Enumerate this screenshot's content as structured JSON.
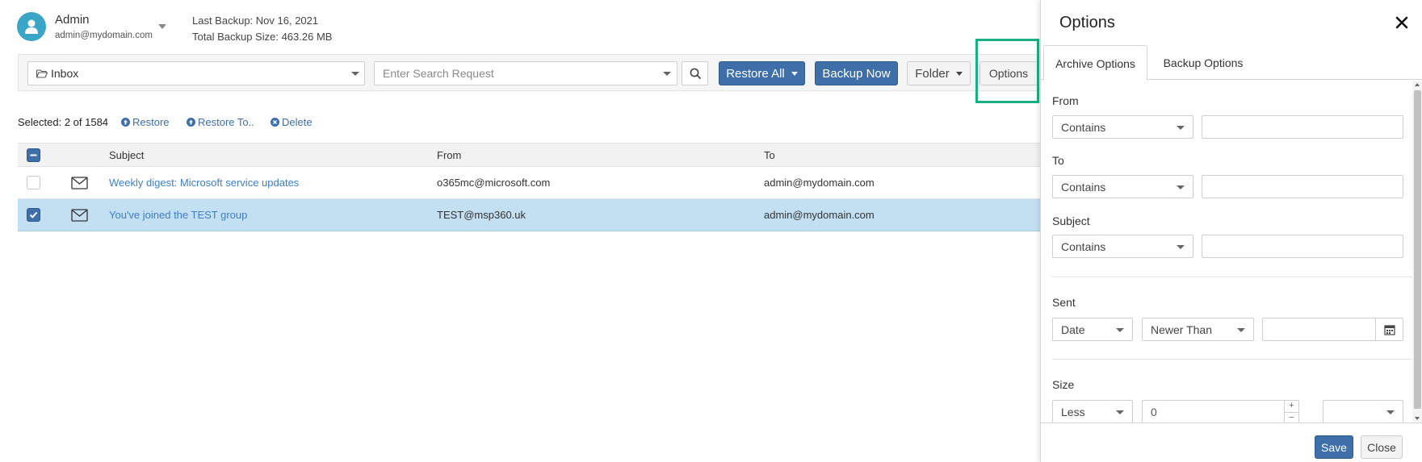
{
  "header": {
    "user_name": "Admin",
    "user_email": "admin@mydomain.com",
    "last_backup_label": "Last Backup:",
    "last_backup_value": "Nov 16, 2021",
    "total_size_label": "Total Backup Size:",
    "total_size_value": "463.26 MB"
  },
  "toolbar": {
    "folder": "Inbox",
    "search_placeholder": "Enter Search Request",
    "restore_all": "Restore All",
    "backup_now": "Backup Now",
    "folder_button": "Folder",
    "options_button": "Options"
  },
  "actions": {
    "selected": "Selected: 2 of 1584",
    "restore": "Restore",
    "restore_to": "Restore To..",
    "delete": "Delete"
  },
  "table": {
    "columns": [
      "Subject",
      "From",
      "To"
    ],
    "rows": [
      {
        "subject": "Weekly digest: Microsoft service updates",
        "from": "o365mc@microsoft.com",
        "to": "admin@mydomain.com",
        "checked": false
      },
      {
        "subject": "You've joined the TEST group",
        "from": "TEST@msp360.uk",
        "to": "admin@mydomain.com",
        "checked": true
      }
    ]
  },
  "panel": {
    "title": "Options",
    "tabs": [
      "Archive Options",
      "Backup Options"
    ],
    "active_tab": "Archive Options",
    "from_label": "From",
    "from_op": "Contains",
    "to_label": "To",
    "to_op": "Contains",
    "subject_label": "Subject",
    "subject_op": "Contains",
    "sent_label": "Sent",
    "sent_type": "Date",
    "sent_op": "Newer Than",
    "size_label": "Size",
    "size_op": "Less",
    "size_value": "0",
    "save": "Save",
    "close": "Close"
  },
  "colors": {
    "primary": "#3e6fa8",
    "highlight": "#1ab083",
    "selected_row": "#c3dff2",
    "avatar": "#3aa5c6"
  }
}
